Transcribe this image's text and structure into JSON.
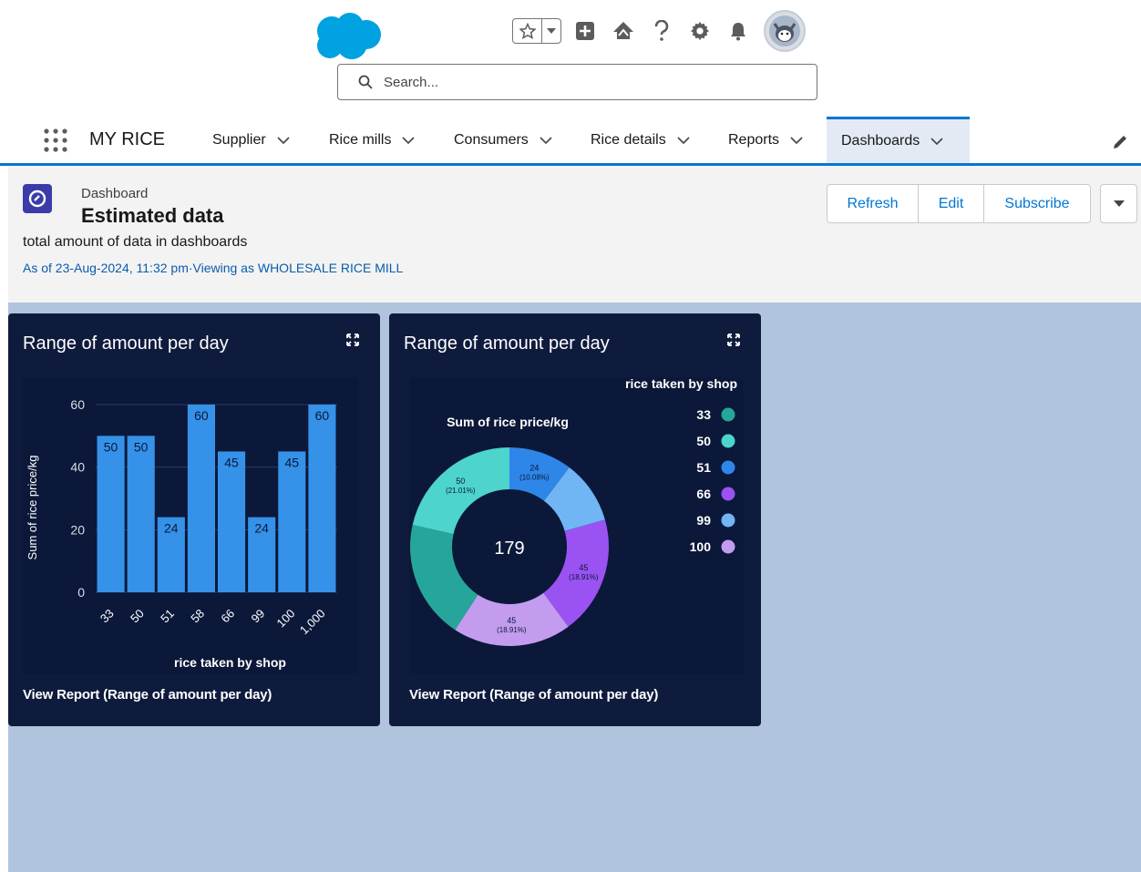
{
  "header": {
    "search_placeholder": "Search...",
    "icons": [
      "salesforce-cloud-logo",
      "star-icon",
      "chevron-down-icon",
      "add-icon",
      "trailhead-icon",
      "help-icon",
      "gear-icon",
      "bell-icon",
      "avatar"
    ]
  },
  "nav": {
    "app_name": "MY RICE",
    "items": [
      {
        "label": "Supplier"
      },
      {
        "label": "Rice mills"
      },
      {
        "label": "Consumers"
      },
      {
        "label": "Rice details"
      },
      {
        "label": "Reports"
      },
      {
        "label": "Dashboards",
        "active": true
      }
    ]
  },
  "dashboard": {
    "type_label": "Dashboard",
    "title": "Estimated data",
    "description": "total amount of data in dashboards",
    "as_of": "As of 23-Aug-2024, 11:32 pm·Viewing as WHOLESALE RICE MILL",
    "buttons": {
      "refresh": "Refresh",
      "edit": "Edit",
      "subscribe": "Subscribe"
    }
  },
  "widgets": [
    {
      "title": "Range of amount per day",
      "view_report": "View Report (Range of amount per day)"
    },
    {
      "title": "Range of amount per day",
      "view_report": "View Report (Range of amount per day)"
    }
  ],
  "colors": {
    "brand_blue": "#0176d3",
    "bar": "#3592e8",
    "widget_bg": "#0f1b3d",
    "canvas_bg": "#b0c4de"
  },
  "chart_data": [
    {
      "type": "bar",
      "title": "Range of amount per day",
      "xlabel": "rice taken by shop",
      "ylabel": "Sum of rice price/kg",
      "categories": [
        "33",
        "50",
        "51",
        "58",
        "66",
        "99",
        "100",
        "1,000"
      ],
      "values": [
        50,
        50,
        24,
        60,
        45,
        24,
        45,
        60
      ],
      "yticks": [
        0,
        20,
        40,
        60
      ],
      "ylim": [
        0,
        60
      ],
      "grid": true
    },
    {
      "type": "pie",
      "subtype": "donut",
      "title": "Range of amount per day",
      "measure_label": "Sum of rice price/kg",
      "legend_title": "rice taken by shop",
      "legend_position": "right",
      "total": "179",
      "slices": [
        {
          "label": "33",
          "value": 45,
          "color": "#26a69a",
          "data_label": ""
        },
        {
          "label": "50",
          "value": 50,
          "color": "#4dd4cc",
          "data_label": "50",
          "pct_label": "(21.01%)"
        },
        {
          "label": "51",
          "value": 24,
          "color": "#2e86e8",
          "data_label": "24",
          "pct_label": "(10.08%)"
        },
        {
          "label": "66",
          "value": 45,
          "color": "#9b52f2",
          "data_label": "45",
          "pct_label": "(18.91%)"
        },
        {
          "label": "99",
          "value": 24,
          "color": "#70b6f5",
          "data_label": ""
        },
        {
          "label": "100",
          "value": 45,
          "color": "#c39cf0",
          "data_label": "45",
          "pct_label": "(18.91%)"
        }
      ]
    }
  ]
}
